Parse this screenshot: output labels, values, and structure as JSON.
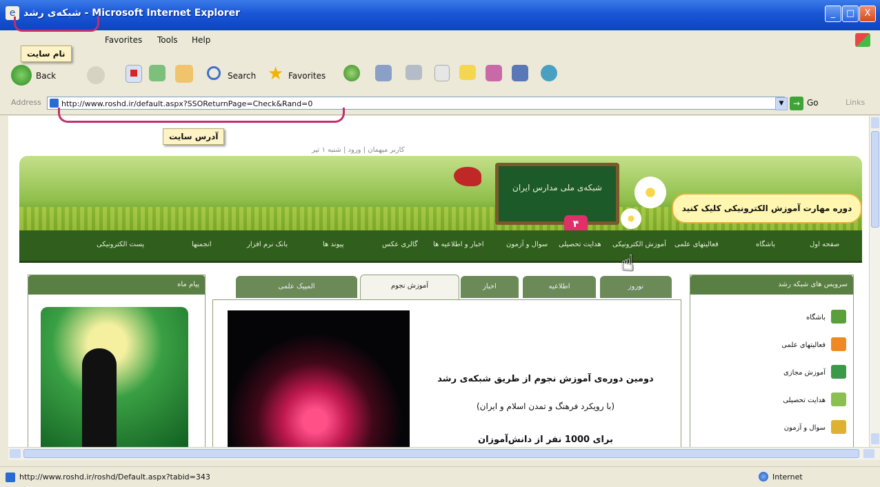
{
  "window": {
    "title": "شبکه‌ی رشد - Microsoft Internet Explorer",
    "minimize_glyph": "_",
    "maximize_glyph": "□",
    "close_glyph": "X"
  },
  "menubar": {
    "items": [
      "Favorites",
      "Tools",
      "Help"
    ]
  },
  "toolbar": {
    "back_label": "Back",
    "search_label": "Search",
    "favorites_label": "Favorites"
  },
  "address": {
    "label": "Address",
    "url": "http://www.roshd.ir/default.aspx?SSOReturnPage=Check&Rand=0",
    "go_label": "Go",
    "links_label": "Links"
  },
  "callouts": {
    "site_name": "نام سایت",
    "site_address": "آدرس سایت",
    "step_number": "۴"
  },
  "site": {
    "top_links": "کاربر میهمان | ورود | شنبه ۱ تیر",
    "board_text": "شبکه‌ی ملی مدارس ایران",
    "promo_text": "دوره مهارت آموزش الکترونیکی کلیک کنید",
    "nav": [
      "صفحه اول",
      "باشگاه",
      "فعالیتهای علمی",
      "آموزش الکترونیکی",
      "هدایت تحصیلی",
      "سوال و آزمون",
      "اخبار و اطلاعیه ها",
      "گالری عکس",
      "پیوند ها",
      "بانک نرم افزار",
      "انجمنها",
      "پست الکترونیکی"
    ],
    "tabs": [
      "نوروز",
      "اطلاعیه",
      "اخبار",
      "آموزش نجوم",
      "المپیک علمی"
    ],
    "right_panel": {
      "title": "سرویس های شبکه رشد",
      "items": [
        "باشگاه",
        "فعالیتهای علمی",
        "آموزش مجازی",
        "هدایت تحصیلی",
        "سوال و آزمون"
      ]
    },
    "left_panel_title": "پیام ماه",
    "article": {
      "line1": "دومین دوره‌ی آموزش نجوم از طریق شبکه‌ی رشد",
      "line2": "(با رویکرد فرهنگ و تمدن اسلام و ایران)",
      "line3": "برای 1000 نفر از دانش‌آموزان"
    }
  },
  "status": {
    "url": "http://www.roshd.ir/roshd/Default.aspx?tabid=343",
    "zone": "Internet"
  },
  "colors": {
    "titlebar": "#1956d6",
    "nav_green": "#2f5e1d",
    "callout_border": "#c0306a"
  }
}
